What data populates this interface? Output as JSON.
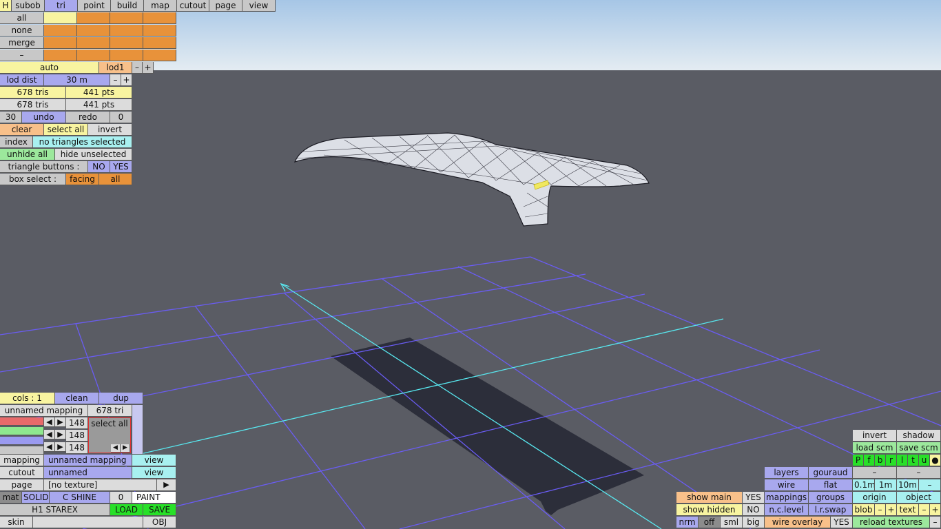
{
  "top_menu": {
    "h": "H",
    "tabs": [
      "subob",
      "tri",
      "point",
      "build",
      "map",
      "cutout",
      "page",
      "view"
    ],
    "active_tab": "tri"
  },
  "select_panel": {
    "all": "all",
    "none": "none",
    "merge": "merge",
    "dash": "–",
    "auto": "auto",
    "lod": "lod1",
    "minus": "–",
    "plus": "+",
    "lod_dist_label": "lod dist",
    "lod_dist_value": "30 m",
    "tris1": "678 tris",
    "pts1": "441 pts",
    "tris2": "678 tris",
    "pts2": "441 pts",
    "undo_count": "30",
    "undo": "undo",
    "redo": "redo",
    "redo_count": "0",
    "clear": "clear",
    "select_all": "select all",
    "invert": "invert",
    "index": "index",
    "selection_status": "no triangles selected",
    "unhide_all": "unhide all",
    "hide_unselected": "hide unselected",
    "triangle_buttons_label": "triangle buttons :",
    "no": "NO",
    "yes": "YES",
    "box_select_label": "box select :",
    "facing": "facing",
    "all_mode": "all"
  },
  "mapping_panel": {
    "cols": "cols : 1",
    "clean": "clean",
    "dup": "dup",
    "mapping_name": "unnamed mapping",
    "tri_count": "678 tri",
    "rgb": [
      "148",
      "148",
      "148"
    ],
    "select_all": "select all",
    "mapping_label": "mapping",
    "mapping_value": "unnamed mapping",
    "view1": "view",
    "cutout_label": "cutout",
    "cutout_value": "unnamed",
    "view2": "view",
    "page_label": "page",
    "page_value": "[no texture]",
    "page_arrow": "▶",
    "mat": "mat",
    "solid": "SOLID",
    "c_shine": "C SHINE",
    "zero": "0",
    "paint": "PAINT",
    "model_name": "H1 STAREX",
    "load": "LOAD",
    "save": "SAVE",
    "skin": "skin",
    "obj": "OBJ"
  },
  "view_panel": {
    "invert": "invert",
    "shadow": "shadow",
    "load_scm": "load scm",
    "save_scm": "save scm",
    "view_letters": [
      "P",
      "f",
      "b",
      "r",
      "l",
      "t",
      "u",
      "●"
    ],
    "layers": "layers",
    "gouraud": "gouraud",
    "dash1": "–",
    "dash2": "–",
    "wire": "wire",
    "flat": "flat",
    "step1": "0.1m",
    "step2": "1m",
    "step3": "10m",
    "step_minus": "–",
    "show_main": "show main",
    "show_main_val": "YES",
    "mappings": "mappings",
    "groups": "groups",
    "origin": "origin",
    "object": "object",
    "show_hidden": "show hidden",
    "show_hidden_val": "NO",
    "nc_level": "n.c.level",
    "lr_swap": "l.r.swap",
    "blob": "blob",
    "blob_minus": "–",
    "blob_plus": "+",
    "text": "text",
    "text_minus": "–",
    "text_plus": "+",
    "nrm": "nrm",
    "off": "off",
    "sml": "sml",
    "big": "big",
    "wire_overlay": "wire overlay",
    "wire_overlay_val": "YES",
    "reload_textures": "reload textures",
    "reload_minus": "–"
  },
  "colors": {
    "sky_top": "#a8c8e8",
    "floor": "#5a5c64",
    "grid": "#6a5cf0",
    "axis": "#58e8f0",
    "shadow": "#2a2c38"
  }
}
